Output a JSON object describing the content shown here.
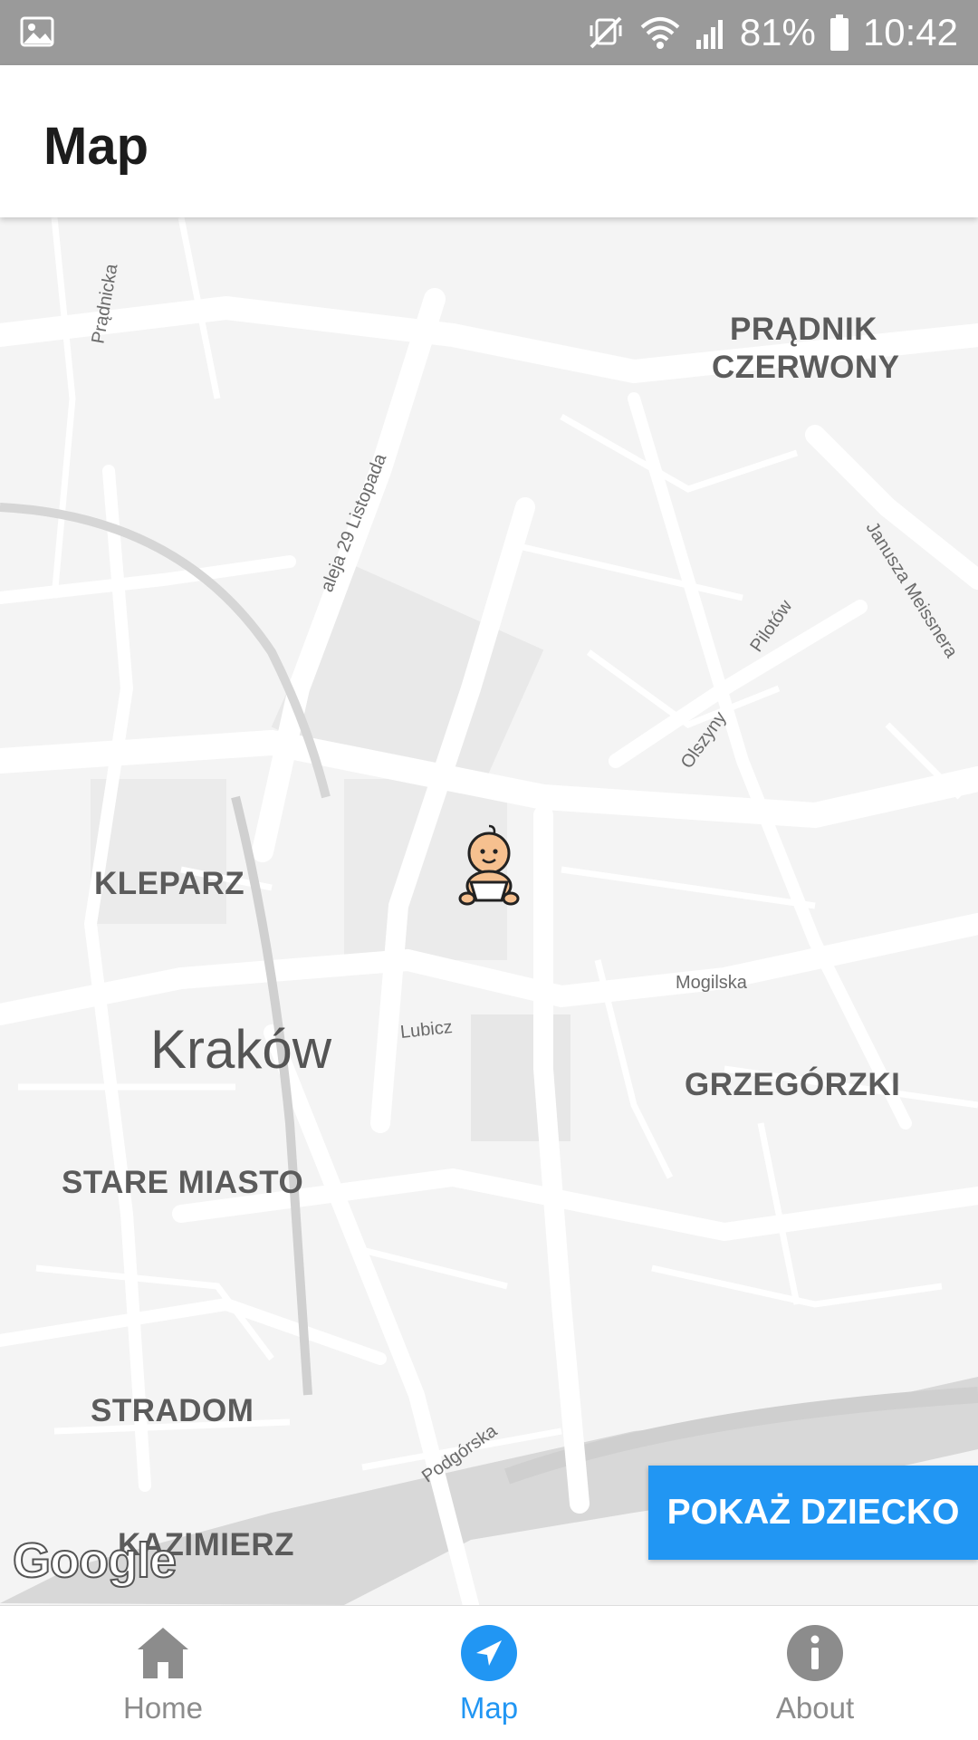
{
  "status_bar": {
    "battery": "81%",
    "time": "10:42",
    "icons": [
      "image-icon",
      "mute-icon",
      "wifi-icon",
      "signal-icon",
      "battery-icon"
    ]
  },
  "header": {
    "title": "Map"
  },
  "map": {
    "city": "Kraków",
    "districts": [
      "PRĄDNIK",
      "CZERWONY",
      "KLEPARZ",
      "GRZEGÓRZKI",
      "STARE MIASTO",
      "STRADOM",
      "KAZIMIERZ"
    ],
    "streets": [
      "Prądnicka",
      "aleja 29 Listopada",
      "Pilotów",
      "Janusza Meissnera",
      "Olszyny",
      "Mogilska",
      "Lubicz",
      "Podgórska"
    ],
    "logo": "Google",
    "marker": "baby-icon"
  },
  "action_button": {
    "label": "POKAŻ DZIECKO"
  },
  "bottom_nav": {
    "items": [
      {
        "label": "Home",
        "icon": "home-icon",
        "active": false
      },
      {
        "label": "Map",
        "icon": "navigation-icon",
        "active": true
      },
      {
        "label": "About",
        "icon": "info-icon",
        "active": false
      }
    ]
  },
  "colors": {
    "accent": "#2196f3",
    "status_bar": "#9a9a9a",
    "inactive": "#8c8c8c"
  }
}
